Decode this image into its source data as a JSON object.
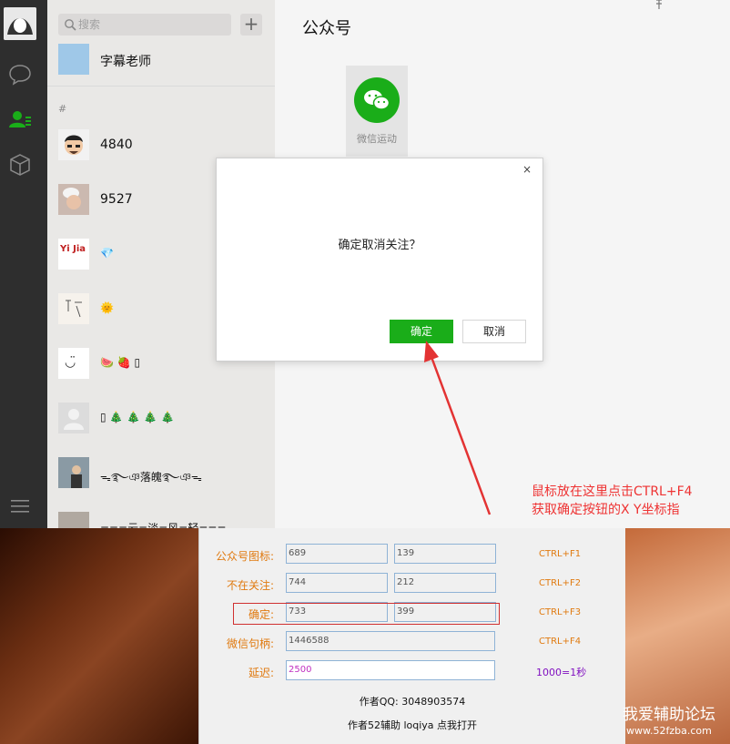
{
  "sidebar": {
    "search_placeholder": "搜索",
    "add_symbol": "+",
    "pinned": "字幕老师",
    "section_header": "#",
    "contacts": [
      {
        "name": "4840"
      },
      {
        "name": "9527"
      },
      {
        "name": "💎",
        "avatar_text": "Yi Jia"
      },
      {
        "name": "🌞"
      },
      {
        "name": "🍉 🍓 ▯",
        "avatar_text": "◡̈"
      },
      {
        "name": "▯ 🎄 🎄 🎄 🎄"
      },
      {
        "name": "ᯓ࿐ঞ落魄࿐ঞᯓ"
      },
      {
        "name": "===云=淡=风=轻==="
      }
    ]
  },
  "main": {
    "title": "公众号",
    "pin_icon": "pin-icon",
    "tile_label": "微信运动"
  },
  "dialog": {
    "close": "×",
    "message": "确定取消关注？",
    "ok": "确定",
    "cancel": "取消"
  },
  "annotation": {
    "line1": "鼠标放在这里点击CTRL+F4",
    "line2": "获取确定按钮的X Y坐标指"
  },
  "tool": {
    "rows": [
      {
        "label": "公众号图标:",
        "x": "689",
        "y": "139",
        "hotkey": "CTRL+F1"
      },
      {
        "label": "不在关注:",
        "x": "744",
        "y": "212",
        "hotkey": "CTRL+F2"
      },
      {
        "label": "确定:",
        "x": "733",
        "y": "399",
        "hotkey": "CTRL+F3"
      }
    ],
    "handle_label": "微信句柄:",
    "handle_value": "1446588",
    "handle_hotkey": "CTRL+F4",
    "delay_label": "延迟:",
    "delay_value": "2500",
    "delay_note": "1000=1秒",
    "author_qq": "作者QQ: 3048903574",
    "author_52": "作者52辅助 loqiya 点我打开"
  },
  "watermark": {
    "line1": "我爱辅助论坛",
    "line2": "www.52fzba.com"
  },
  "colors": {
    "wechat_green": "#1aad19",
    "hotkey_orange": "#e07a10",
    "annotation_red": "#e33333"
  }
}
